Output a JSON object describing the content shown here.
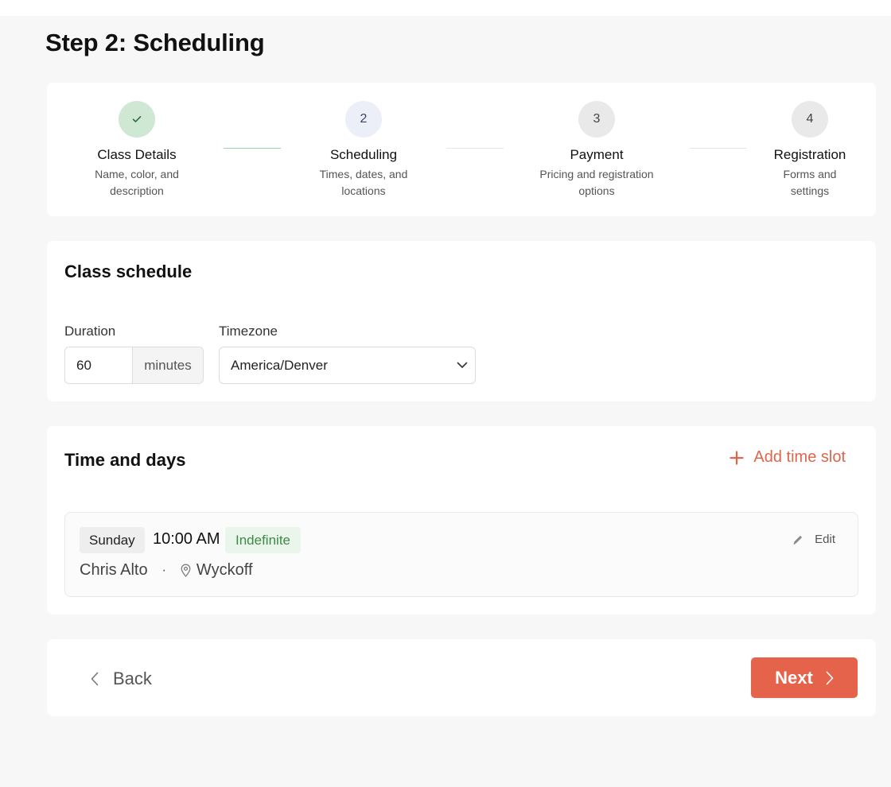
{
  "page": {
    "title": "Step 2: Scheduling"
  },
  "stepper": {
    "steps": [
      {
        "number": "1",
        "title": "Class Details",
        "desc_line1": "Name, color, and",
        "desc_line2": "description",
        "state": "complete"
      },
      {
        "number": "2",
        "title": "Scheduling",
        "desc_line1": "Times, dates, and",
        "desc_line2": "locations",
        "state": "current"
      },
      {
        "number": "3",
        "title": "Payment",
        "desc_line1": "Pricing and registration",
        "desc_line2": "options",
        "state": "pending"
      },
      {
        "number": "4",
        "title": "Registration",
        "desc_line1": "Forms and",
        "desc_line2": "settings",
        "state": "pending"
      }
    ]
  },
  "schedule": {
    "title": "Class schedule",
    "duration_label": "Duration",
    "duration_value": "60",
    "duration_unit": "minutes",
    "timezone_label": "Timezone",
    "timezone_value": "America/Denver"
  },
  "time_days": {
    "title": "Time and days",
    "add_label": "Add time slot",
    "slots": [
      {
        "day": "Sunday",
        "time": "10:00 AM",
        "recurrence": "Indefinite",
        "instructor": "Chris Alto",
        "separator": "·",
        "location": "Wyckoff",
        "edit_label": "Edit"
      }
    ]
  },
  "nav": {
    "back_label": "Back",
    "next_label": "Next"
  },
  "colors": {
    "accent": "#e5634a",
    "success": "#3e8a44",
    "step_done": "#cfe8d3",
    "step_current": "#eceef8"
  },
  "icons": {
    "step1": "check-icon",
    "add": "plus-icon",
    "location": "map-pin-icon",
    "edit": "pencil-icon",
    "back": "chevron-left-icon",
    "next": "chevron-right-icon",
    "select": "chevron-down-icon"
  }
}
